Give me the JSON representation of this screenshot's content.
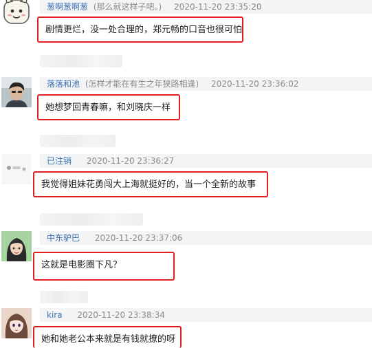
{
  "comments": [
    {
      "username": "葱啊葱啊葱",
      "signature": "(那么就这样子吧。)",
      "timestamp": "2020-11-20 23:35:20",
      "text": "剧情更烂，没一处合理的，郑元畅的口音也很可怕",
      "avatar_icon": "cat-cartoon-avatar"
    },
    {
      "username": "落落和池",
      "signature": "(怎样才能在有生之年狭路相逢)",
      "timestamp": "2020-11-20 23:36:02",
      "text": "她想梦回青春嘛，和刘晓庆一样",
      "avatar_icon": "man-photo-avatar"
    },
    {
      "username": "已注销",
      "signature": "",
      "timestamp": "2020-11-20 23:36:27",
      "text": "我觉得姐妹花勇闯大上海就挺好的，当一个全新的故事",
      "avatar_icon": "deleted-user-avatar"
    },
    {
      "username": "中东驴巴",
      "signature": "",
      "timestamp": "2020-11-20 23:37:06",
      "text": "这就是电影圈下凡？",
      "avatar_icon": "cartoon-girl-avatar"
    },
    {
      "username": "kira",
      "signature": "",
      "timestamp": "2020-11-20 23:38:34",
      "text": "她和她老公本来就是有钱就撩的呀",
      "avatar_icon": "anime-girl-avatar"
    }
  ],
  "colors": {
    "highlight_border": "#e02020",
    "username": "#3a6fb0",
    "meta_bg": "#f3f4f6"
  }
}
